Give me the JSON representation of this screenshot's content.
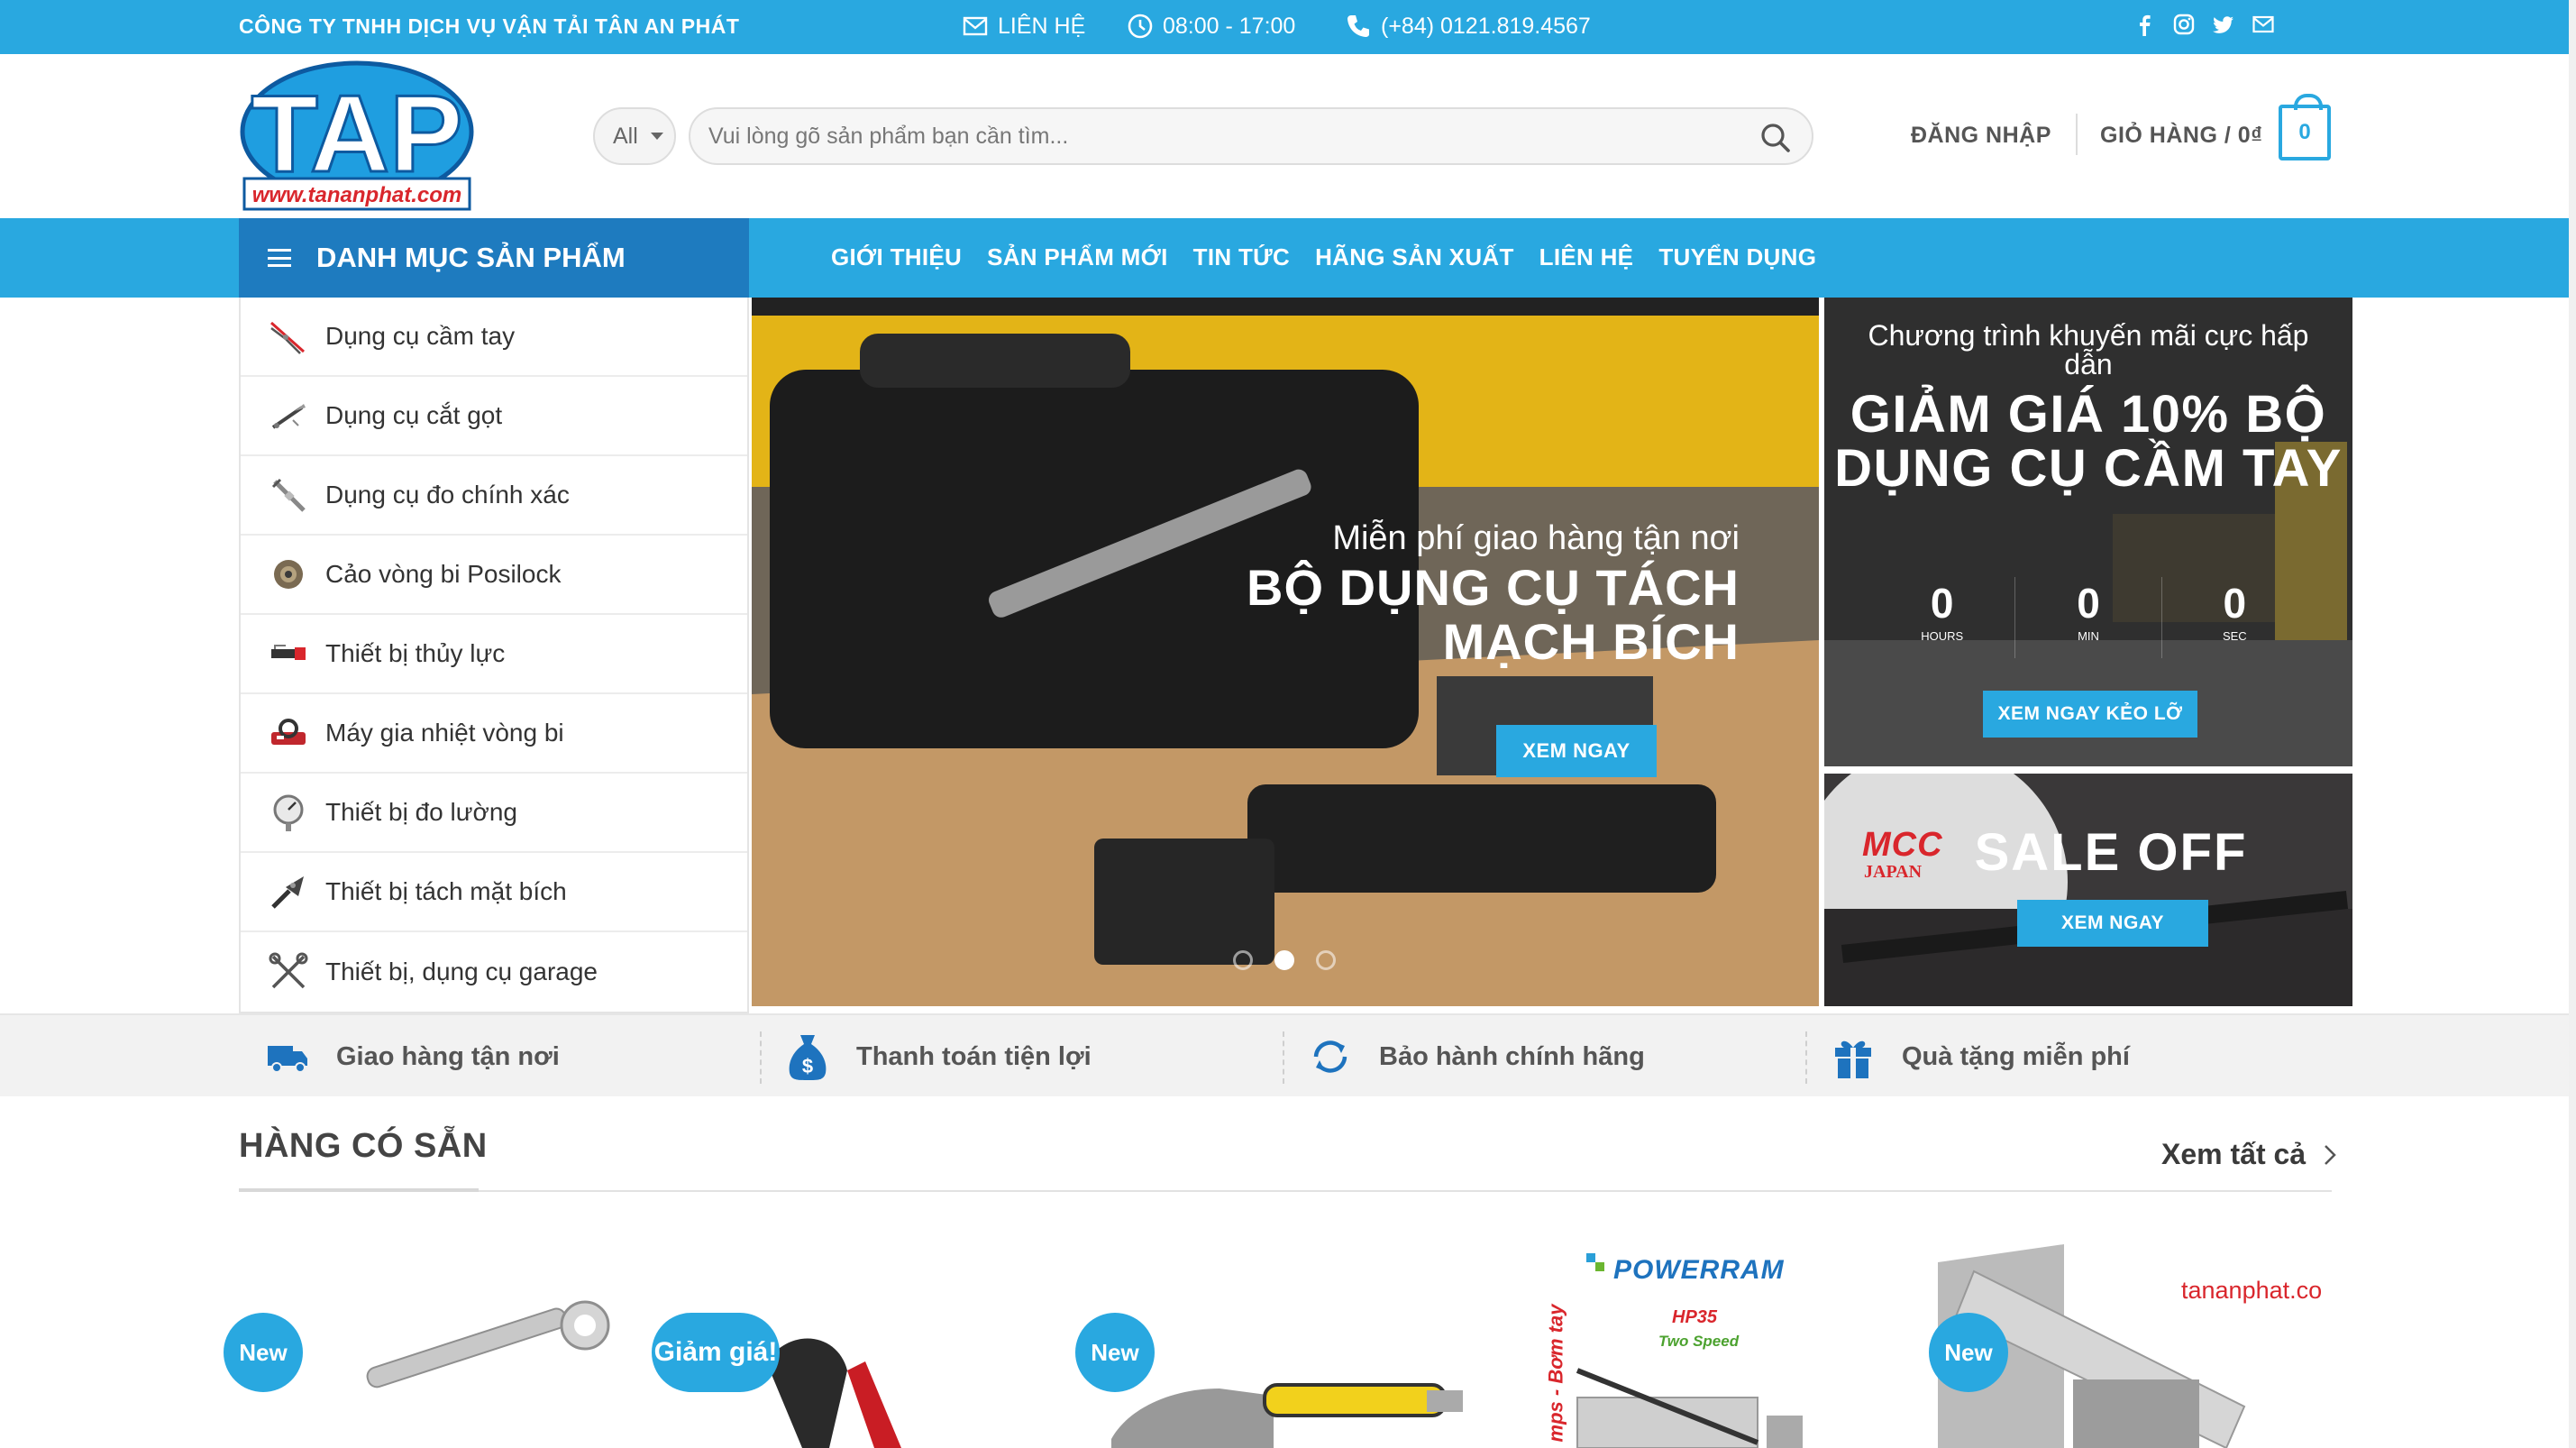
{
  "topbar": {
    "company": "CÔNG TY TNHH DỊCH VỤ VẬN TẢI TÂN AN PHÁT",
    "contact_label": "LIÊN HỆ",
    "hours": "08:00 - 17:00",
    "phone": "(+84) 0121.819.4567",
    "social": [
      "facebook-icon",
      "instagram-icon",
      "twitter-icon",
      "email-icon"
    ]
  },
  "header": {
    "logo_text": "TAP",
    "logo_url_text": "www.tananphat.com",
    "search_category": "All",
    "search_placeholder": "Vui lòng gõ sản phẩm bạn cần tìm...",
    "login": "ĐĂNG NHẬP",
    "cart_label": "GIỎ HÀNG / 0₫",
    "cart_count": "0"
  },
  "nav": {
    "category_title": "DANH MỤC SẢN PHẨM",
    "links": [
      "GIỚI THIỆU",
      "SẢN PHẨM MỚI",
      "TIN TỨC",
      "HÃNG SẢN XUẤT",
      "LIÊN HỆ",
      "TUYỂN DỤNG"
    ]
  },
  "sidebar": {
    "items": [
      {
        "label": "Dụng cụ cầm tay",
        "icon": "pliers-icon"
      },
      {
        "label": "Dụng cụ cắt gọt",
        "icon": "cutter-icon"
      },
      {
        "label": "Dụng cụ đo chính xác",
        "icon": "caliper-icon"
      },
      {
        "label": "Cảo vòng bi Posilock",
        "icon": "puller-icon"
      },
      {
        "label": "Thiết bị thủy lực",
        "icon": "hydraulic-icon"
      },
      {
        "label": "Máy gia nhiệt vòng bi",
        "icon": "heater-icon"
      },
      {
        "label": "Thiết bị đo lường",
        "icon": "gauge-icon"
      },
      {
        "label": "Thiết bị tách mặt bích",
        "icon": "flange-spreader-icon"
      },
      {
        "label": "Thiết bị, dụng cụ garage",
        "icon": "tools-icon"
      }
    ]
  },
  "hero": {
    "subtitle": "Miễn phí giao hàng tận nơi",
    "title": "BỘ DỤNG CỤ TÁCH MẠCH BÍCH",
    "button": "XEM NGAY",
    "dot_count": 3,
    "active_dot": 1
  },
  "promo1": {
    "small": "Chương trình khuyến mãi cực hấp dẫn",
    "big": "GIẢM GIÁ 10% BỘ DỤNG CỤ CẦM TAY",
    "countdown": [
      {
        "value": "0",
        "label": "HOURS"
      },
      {
        "value": "0",
        "label": "MIN"
      },
      {
        "value": "0",
        "label": "SEC"
      }
    ],
    "button": "XEM NGAY KẺO LỠ"
  },
  "promo2": {
    "brand": "MCC",
    "brand_sub": "JAPAN",
    "title": "SALE OFF",
    "button": "XEM NGAY"
  },
  "features": [
    {
      "label": "Giao hàng tận nơi",
      "icon": "truck-icon"
    },
    {
      "label": "Thanh toán tiện lợi",
      "icon": "money-bag-icon"
    },
    {
      "label": "Bảo hành chính hãng",
      "icon": "refresh-icon"
    },
    {
      "label": "Quà tặng miễn phí",
      "icon": "gift-icon"
    }
  ],
  "section": {
    "title": "HÀNG CÓ SẴN",
    "see_all": "Xem tất cả"
  },
  "products": [
    {
      "badge": "New"
    },
    {
      "badge": "Giảm giá!"
    },
    {
      "badge": "New"
    },
    {
      "badge": "",
      "brand": "POWERRAM",
      "model": "HP35",
      "model_sub": "Two Speed",
      "side_text": "mps - Bơm tay"
    },
    {
      "badge": "New",
      "watermark": "tananphat.co"
    }
  ],
  "colors": {
    "primary": "#29a8e0",
    "nav_dark": "#1e7bbf",
    "feature_bg": "#f2f2f2"
  }
}
